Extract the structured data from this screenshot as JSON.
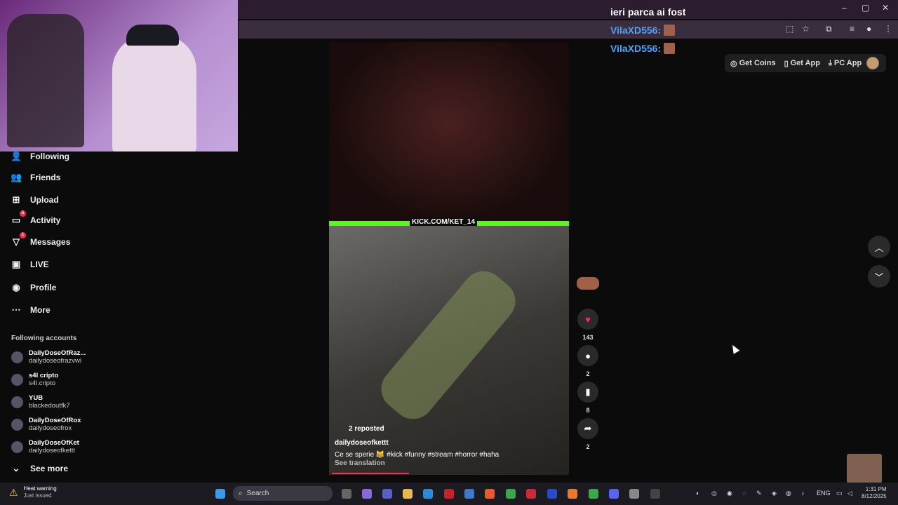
{
  "chat": [
    {
      "name": "",
      "message": "ieri parca ai fost"
    },
    {
      "name": "VilaXD556:",
      "message": ""
    },
    {
      "name": "VilaXD556:",
      "message": ""
    }
  ],
  "top_buttons": {
    "coins": "Get Coins",
    "app": "Get App",
    "pc": "PC App"
  },
  "nav": [
    {
      "label": "Following",
      "icon": "following-icon"
    },
    {
      "label": "Friends",
      "icon": "friends-icon"
    },
    {
      "label": "Upload",
      "icon": "upload-icon"
    },
    {
      "label": "Activity",
      "icon": "activity-icon",
      "badge": "5"
    },
    {
      "label": "Messages",
      "icon": "messages-icon",
      "badge": "1"
    },
    {
      "label": "LIVE",
      "icon": "live-icon"
    },
    {
      "label": "Profile",
      "icon": "profile-icon"
    },
    {
      "label": "More",
      "icon": "more-icon"
    }
  ],
  "following_label": "Following accounts",
  "accounts": [
    {
      "name": "DailyDoseOfRaz...",
      "handle": "dailydoseofrazvwi"
    },
    {
      "name": "s4l cripto",
      "handle": "s4l.cripto"
    },
    {
      "name": "YUB",
      "handle": "blackedoutfk7"
    },
    {
      "name": "DailyDoseOfRox",
      "handle": "dailydoseofrox"
    },
    {
      "name": "DailyDoseOfKet",
      "handle": "dailydoseofkettt"
    }
  ],
  "see_more": "See more",
  "video": {
    "overlay_text": "KICK.COM/KET_14",
    "reposted": "2 reposted",
    "author": "dailydoseofkettt",
    "caption": "Ce se sperie 😹 #kick #funny #stream #horror #haha",
    "see_translation": "See translation"
  },
  "actions": {
    "likes": "143",
    "comments": "2",
    "saves": "8",
    "shares": "2"
  },
  "taskbar": {
    "heat_title": "Heat warning",
    "heat_sub": "Just issued",
    "search": "Search",
    "lang": "ENG",
    "time": "1:31 PM",
    "date": "8/12/2025"
  },
  "colors": {
    "accent": "#fe2c55",
    "kick": "#53fc18",
    "chat_name": "#4fa3ff"
  }
}
